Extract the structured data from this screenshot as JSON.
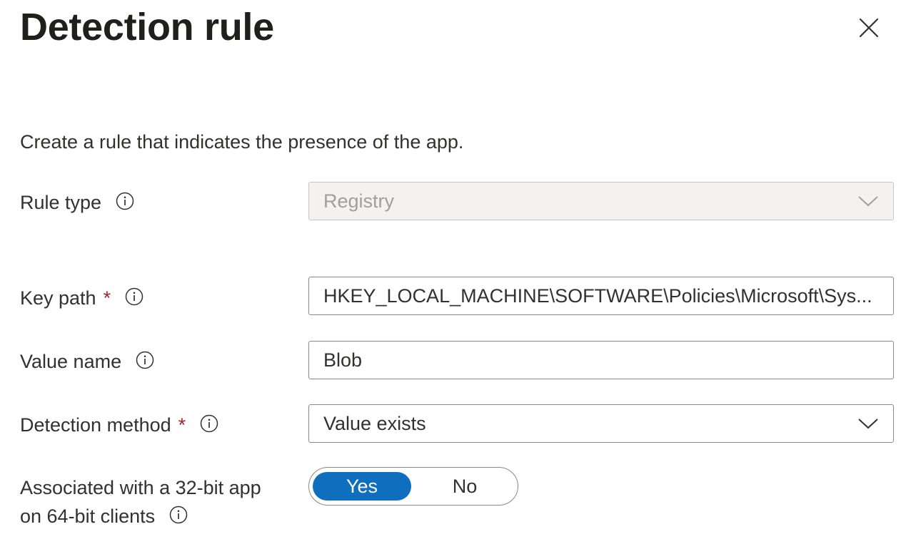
{
  "panel": {
    "title": "Detection rule",
    "description": "Create a rule that indicates the presence of the app."
  },
  "fields": {
    "rule_type": {
      "label": "Rule type",
      "value": "Registry"
    },
    "key_path": {
      "label": "Key path",
      "required_mark": "*",
      "value": "HKEY_LOCAL_MACHINE\\SOFTWARE\\Policies\\Microsoft\\Sys..."
    },
    "value_name": {
      "label": "Value name",
      "value": "Blob"
    },
    "detection_method": {
      "label": "Detection method",
      "required_mark": "*",
      "value": "Value exists"
    },
    "associated_32bit": {
      "label_line1": "Associated with a 32-bit app",
      "label_line2": "on 64-bit clients",
      "options": [
        "Yes",
        "No"
      ],
      "selected": "Yes"
    }
  },
  "icons": {
    "close": "close-icon",
    "info": "info-icon",
    "dropdown": "chevron-down-icon"
  },
  "colors": {
    "accent": "#106ebe",
    "required": "#a4262c",
    "disabled_bg": "#f3f2f1"
  }
}
